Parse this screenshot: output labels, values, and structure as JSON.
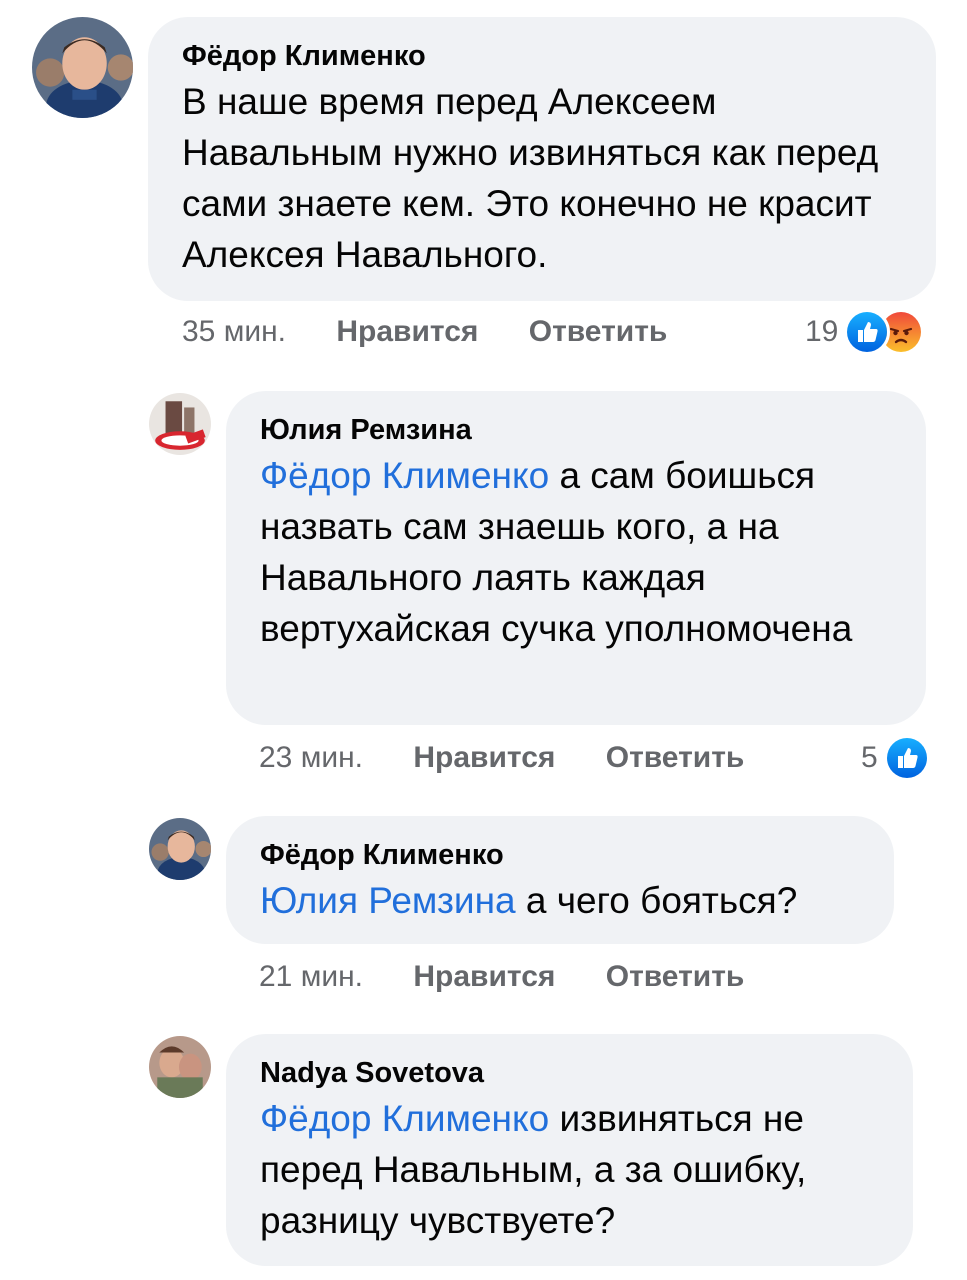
{
  "comments": [
    {
      "author": "Фёдор Клименко",
      "mention": "",
      "text": "В наше время перед Алексеем Навальным нужно извиняться как перед сами знаете кем. Это конечно не красит Алексея Навального.",
      "time": "35 мин.",
      "like_label": "Нравится",
      "reply_label": "Ответить",
      "reaction_count": "19",
      "reactions": [
        "like-icon",
        "angry-icon"
      ]
    },
    {
      "author": "Юлия Ремзина",
      "mention": "Фёдор Клименко",
      "text": " а сам боишься назвать сам знаешь кого, а на Навального лаять каждая вертухайская сучка уполномочена",
      "time": "23 мин.",
      "like_label": "Нравится",
      "reply_label": "Ответить",
      "reaction_count": "5",
      "reactions": [
        "like-icon"
      ]
    },
    {
      "author": "Фёдор Клименко",
      "mention": "Юлия Ремзина",
      "text": " а чего бояться?",
      "time": "21 мин.",
      "like_label": "Нравится",
      "reply_label": "Ответить"
    },
    {
      "author": "Nadya Sovetova",
      "mention": "Фёдор Клименко",
      "text": " извиняться не перед Навальным, а за ошибку, разницу чувствуете?"
    }
  ],
  "colors": {
    "bubble": "#f0f2f5",
    "mention": "#216fdb",
    "meta": "#65676b",
    "like": "#1877f2",
    "angry": "#f25268"
  }
}
